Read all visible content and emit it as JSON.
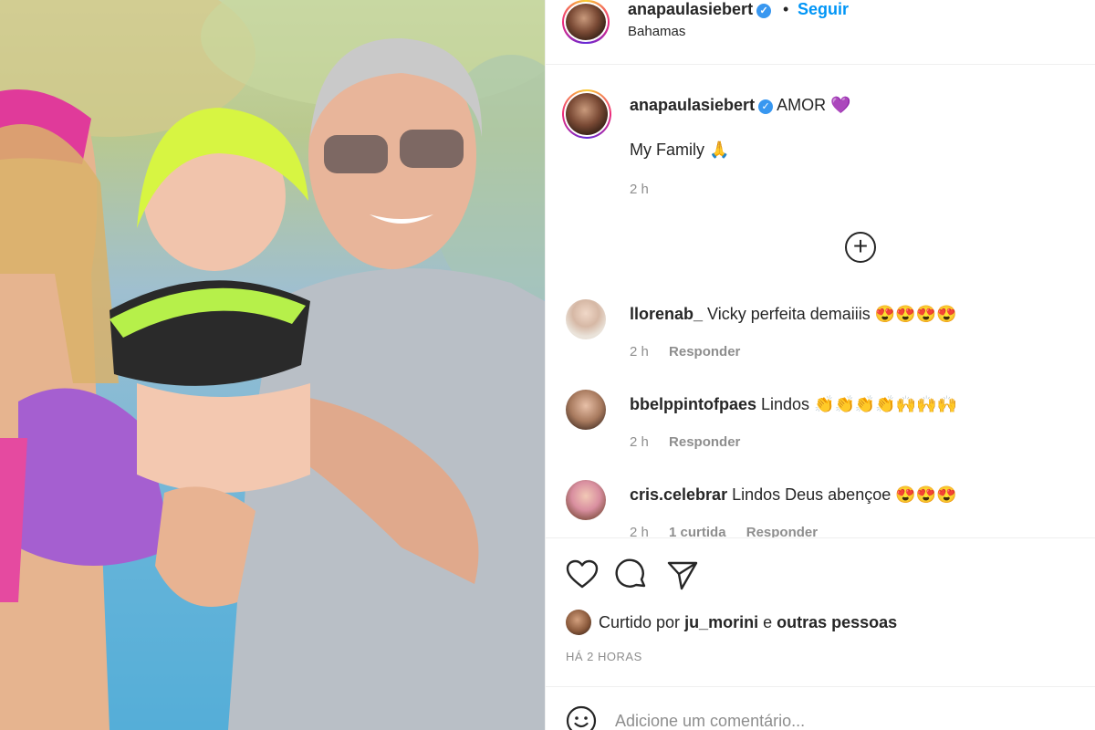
{
  "post": {
    "username": "anapaulasiebert",
    "follow_label": "Seguir",
    "separator": "•",
    "location": "Bahamas"
  },
  "caption": {
    "username": "anapaulasiebert",
    "title": "AMOR",
    "title_emoji": "💜",
    "text": "My Family",
    "text_emoji": "🙏",
    "time": "2 h"
  },
  "load_more_icon": "plus-circle-icon",
  "comments": [
    {
      "username": "llorenab_",
      "text": "Vicky perfeita demaiiis",
      "emojis": "😍😍😍😍",
      "time": "2 h",
      "likes": "",
      "reply": "Responder"
    },
    {
      "username": "bbelppintofpaes",
      "text": "Lindos",
      "emojis": "👏👏👏👏🙌🙌🙌",
      "time": "2 h",
      "likes": "",
      "reply": "Responder"
    },
    {
      "username": "cris.celebrar",
      "text": "Lindos Deus abençoe",
      "emojis": "😍😍😍",
      "time": "2 h",
      "likes": "1 curtida",
      "reply": "Responder"
    }
  ],
  "actions": {
    "like_icon": "heart-icon",
    "comment_icon": "comment-icon",
    "share_icon": "paper-plane-icon"
  },
  "likes": {
    "prefix": "Curtido por",
    "user": "ju_morini",
    "connector": "e",
    "others": "outras pessoas"
  },
  "time_ago": "HÁ 2 HORAS",
  "add_comment": {
    "placeholder": "Adicione um comentário...",
    "emoji_icon": "smiley-icon"
  },
  "colors": {
    "link_blue": "#0095f6",
    "verified_blue": "#3897f0",
    "muted_gray": "#8e8e8e",
    "text": "#262626"
  }
}
